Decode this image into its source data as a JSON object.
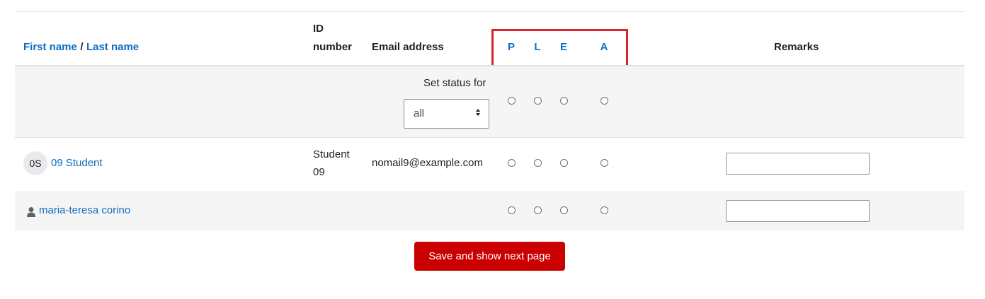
{
  "header": {
    "first_name": "First name",
    "name_sep": "/",
    "last_name": "Last name",
    "id_number_line1": "ID",
    "id_number_line2": "number",
    "email": "Email address",
    "statuses": [
      "P",
      "L",
      "E",
      "A"
    ],
    "remarks": "Remarks"
  },
  "set_status": {
    "label": "Set status for",
    "selected": "all"
  },
  "rows": [
    {
      "initials": "0S",
      "name": "09 Student",
      "id_line1": "Student",
      "id_line2": "09",
      "email": "nomail9@example.com"
    },
    {
      "name": "maria-teresa corino",
      "id_line1": "",
      "id_line2": "",
      "email": ""
    }
  ],
  "save_button": "Save and show next page",
  "colors": {
    "link": "#0f6cbf",
    "highlight": "#d9222a",
    "button": "#ca0000"
  }
}
